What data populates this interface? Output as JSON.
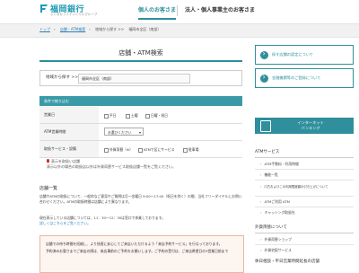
{
  "brand": {
    "name": "福岡銀行",
    "subtitle": "ふくおかフィナンシャルグループ",
    "accent": "#2f8f9c"
  },
  "nav": {
    "personal": "個人のお客さま",
    "business": "法人・個人事業主のお客さま"
  },
  "breadcrumb": [
    "トップ",
    "店舗・ATM検索",
    "地域から探す >>",
    "福岡市全区（南部）"
  ],
  "page": {
    "title": "店舗・ATM検索"
  },
  "region": {
    "label": "地域から探す >>",
    "value": "福岡市全区（南部）"
  },
  "conditions": {
    "header": "条件で絞り込む",
    "rows": [
      {
        "label": "営業日",
        "options": [
          "平日",
          "土曜",
          "日曜・祝日"
        ]
      },
      {
        "label": "ATM営業時間",
        "select": "お選びください"
      },
      {
        "label": "取扱サービス・設備",
        "options": [
          "外貨両替（※）",
          "ATMで区にサービス",
          "駐車場"
        ]
      }
    ]
  },
  "notes": [
    "表示を取扱い店舗",
    "表示以外の場合の取扱店以外は外貨両替サービス取扱店舗一覧をご覧ください。"
  ],
  "list": {
    "title": "店舗一覧",
    "para1": "店舗やATMの取扱について、一般的なご意見やご質問は月～金曜日 9:00～17:00（祝日を除く）の間、当社フリーダイヤルにお問い合わせください。ATMの取扱時間は店舗により異なります。",
    "para2": "現在表示している店舗については、11：30～12：30は窓口で休業しております。",
    "para2_link": "詳しくはこちらをご覧ください。"
  },
  "notice": {
    "line1": "店舗での待ち時間を短縮し、より快適に安心してご来店いただけるよう「来店予約サービス」を行なっております。",
    "line2": "予約済みお客さまでご来店の際は、来店事前のご予約をお願いします。ご予約の受付は、ご来店希望日の3営業日前まで"
  },
  "sidebar": {
    "btn1": "探す店舗の認定について",
    "btn2": "金融機関等のご登録について",
    "internet": [
      "インターネット",
      "バンキング"
    ],
    "section1": "ATMサービス",
    "links1": [
      "ATM手数料・利用時間",
      "機能一覧",
      "口方およびこの利用限度額の引き上げについて",
      "ATMご利用 ATM",
      "キャッシング取扱先"
    ],
    "section2": "外貨両替について",
    "links2": [
      "外貨両替ショップ",
      "外貨宅配サービス"
    ],
    "section3": "休日相談・平日営業時間延長の店舗"
  }
}
